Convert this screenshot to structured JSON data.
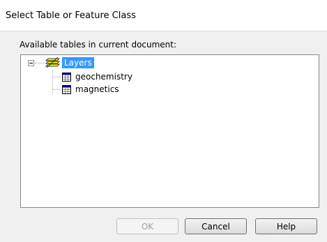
{
  "window": {
    "title": "Select Table or Feature Class"
  },
  "prompt": "Available tables in current document:",
  "tree": {
    "root": {
      "label": "Layers",
      "expanded": true,
      "selected": true,
      "icon": "layers-icon"
    },
    "children": [
      {
        "label": "geochemistry",
        "icon": "table-icon"
      },
      {
        "label": "magnetics",
        "icon": "table-icon"
      }
    ]
  },
  "buttons": {
    "ok": "OK",
    "cancel": "Cancel",
    "help": "Help"
  },
  "colors": {
    "selection": "#3399ff",
    "dialog_bg": "#f0f0f0"
  }
}
